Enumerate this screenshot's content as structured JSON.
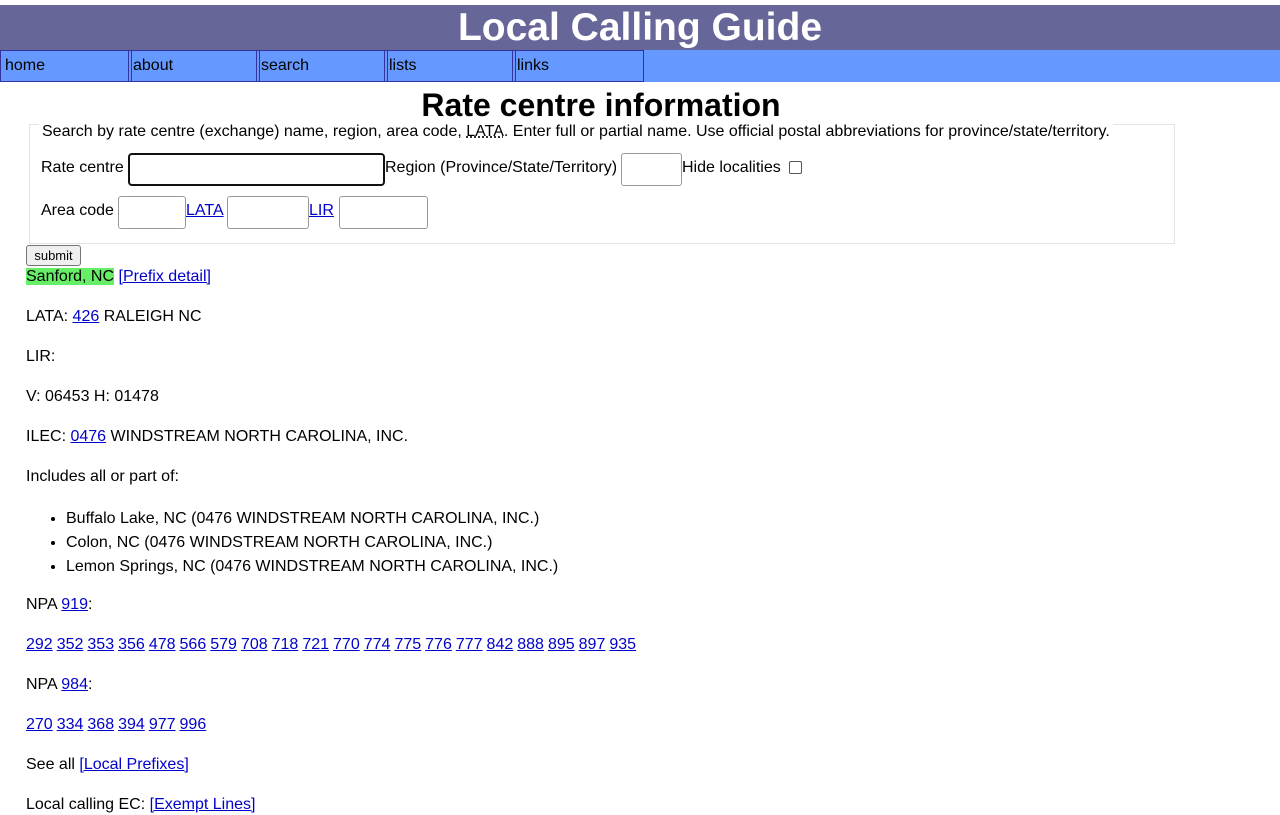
{
  "header": {
    "title": "Local Calling Guide"
  },
  "nav": [
    {
      "label": "home"
    },
    {
      "label": "about"
    },
    {
      "label": "search"
    },
    {
      "label": "lists"
    },
    {
      "label": "links"
    }
  ],
  "page_title": "Rate centre information",
  "search_form": {
    "legend_before": "Search by rate centre (exchange) name, region, area code, ",
    "legend_abbr": "LATA",
    "legend_after": ". Enter full or partial name. Use official postal abbreviations for province/state/territory.",
    "rate_centre_label": "Rate centre",
    "rate_centre_value": "",
    "region_label": "Region (Province/State/Territory)",
    "region_value": "",
    "hide_localities_label": "Hide localities",
    "hide_localities_checked": false,
    "area_code_label": "Area code",
    "area_code_value": "",
    "lata_link": "LATA",
    "lata_value": "",
    "lir_link": "LIR",
    "lir_value": "",
    "submit_label": "submit"
  },
  "result": {
    "rate_centre": "Sanford, NC",
    "prefix_detail_link": "[Prefix detail]",
    "lata_label": "LATA:",
    "lata_code": "426",
    "lata_name": "RALEIGH NC",
    "lir_label": "LIR:",
    "vh_text": "V: 06453 H: 01478",
    "ilec_label": "ILEC:",
    "ilec_code": "0476",
    "ilec_name": "WINDSTREAM NORTH CAROLINA, INC.",
    "includes_label": "Includes all or part of:",
    "includes": [
      "Buffalo Lake, NC (0476 WINDSTREAM NORTH CAROLINA, INC.)",
      "Colon, NC (0476 WINDSTREAM NORTH CAROLINA, INC.)",
      "Lemon Springs, NC (0476 WINDSTREAM NORTH CAROLINA, INC.)"
    ],
    "npa_label": "NPA",
    "npa_groups": [
      {
        "npa": "919",
        "prefixes": [
          "292",
          "352",
          "353",
          "356",
          "478",
          "566",
          "579",
          "708",
          "718",
          "721",
          "770",
          "774",
          "775",
          "776",
          "777",
          "842",
          "888",
          "895",
          "897",
          "935"
        ]
      },
      {
        "npa": "984",
        "prefixes": [
          "270",
          "334",
          "368",
          "394",
          "977",
          "996"
        ]
      }
    ],
    "see_all_label": "See all",
    "local_prefixes_link": "[Local Prefixes]",
    "cutoff_label": "Local calling EC:",
    "cutoff_link": "[Exempt Lines]"
  },
  "colors": {
    "banner": "#666699",
    "nav": "#6699ff",
    "highlight": "#66ee66",
    "link": "#0000cc"
  }
}
